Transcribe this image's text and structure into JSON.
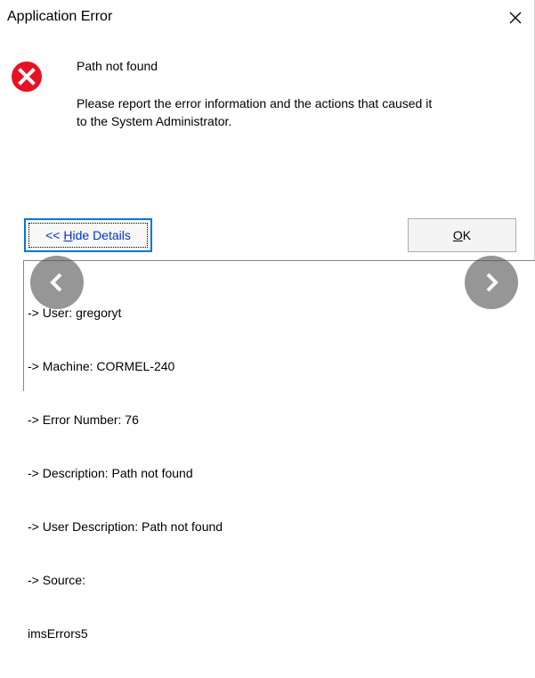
{
  "window": {
    "title": "Application Error"
  },
  "message": {
    "main": "Path not found",
    "detail_line1": "Please report the error information and the actions that caused it",
    "detail_line2": "to the System Administrator."
  },
  "buttons": {
    "details_prefix": "<< ",
    "details_mnemonic": "H",
    "details_rest": "ide Details",
    "ok_mnemonic": "O",
    "ok_rest": "K"
  },
  "details": {
    "lines": [
      "-> User: gregoryt",
      "-> Machine: CORMEL-240",
      "-> Error Number: 76",
      "-> Description: Path not found",
      "-> User Description: Path not found",
      "-> Source:",
      "imsErrors5"
    ]
  },
  "icons": {
    "error": "error-circle-x-icon",
    "close": "close-icon",
    "prev": "chevron-left-icon",
    "next": "chevron-right-icon"
  },
  "colors": {
    "error_red": "#e81123",
    "focus_blue": "#0078d7",
    "link_blue": "#0033cc"
  }
}
